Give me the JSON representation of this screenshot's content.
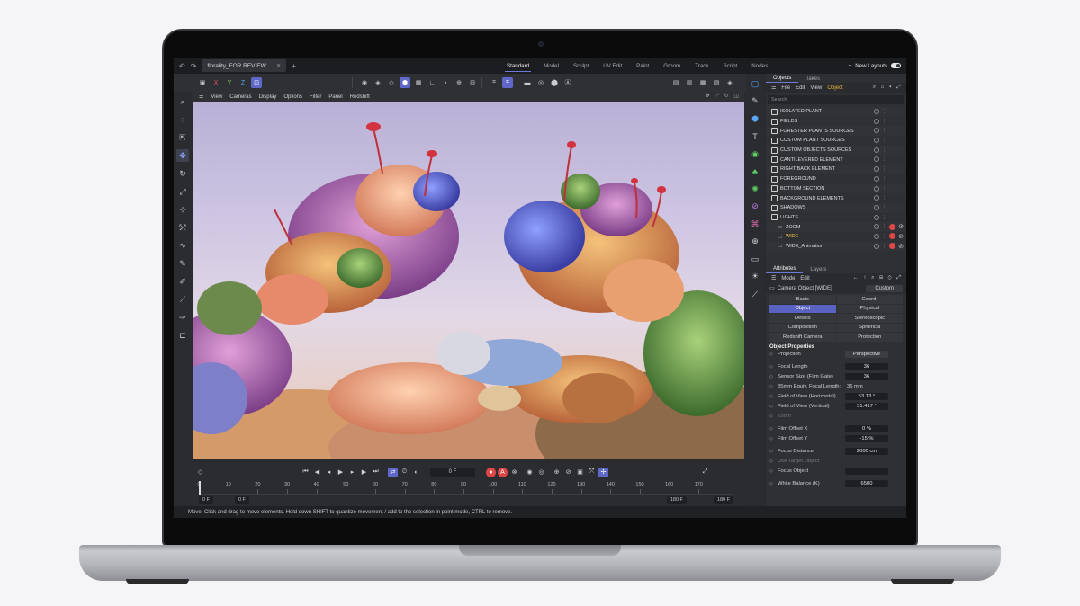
{
  "window": {
    "doc_tab": "florality_FOR REVIEW...",
    "layouts": [
      "Standard",
      "Model",
      "Sculpt",
      "UV Edit",
      "Paint",
      "Groom",
      "Track",
      "Script",
      "Nodes"
    ],
    "active_layout": "Standard",
    "new_layouts_label": "New Layouts"
  },
  "viewport_menu": [
    "View",
    "Cameras",
    "Display",
    "Options",
    "Filter",
    "Panel",
    "Redshift"
  ],
  "axis_labels": [
    "X",
    "Y",
    "Z"
  ],
  "objects_panel": {
    "tabs": [
      "Objects",
      "Takes"
    ],
    "menu": [
      "File",
      "Edit",
      "View",
      "Object"
    ],
    "search_placeholder": "Search",
    "items": [
      {
        "label": "ISOLATED PLANT",
        "kind": "layer"
      },
      {
        "label": "FIELDS",
        "kind": "layer"
      },
      {
        "label": "FORESTER PLANTS SOURCES",
        "kind": "layer"
      },
      {
        "label": "CUSTOM PLANT SOURCES",
        "kind": "layer"
      },
      {
        "label": "CUSTOM OBJECTS SOURCES",
        "kind": "layer"
      },
      {
        "label": "CANTILEVERED ELEMENT",
        "kind": "layer"
      },
      {
        "label": "RIGHT BACK ELEMENT",
        "kind": "layer"
      },
      {
        "label": "FOREGROUND",
        "kind": "layer"
      },
      {
        "label": "BOTTOM SECTION",
        "kind": "layer"
      },
      {
        "label": "BACKGROUND ELEMENTS",
        "kind": "layer"
      },
      {
        "label": "SHADOWS",
        "kind": "layer"
      },
      {
        "label": "LIGHTS",
        "kind": "layer"
      },
      {
        "label": "ZOOM",
        "kind": "camera"
      },
      {
        "label": "WIDE",
        "kind": "camera",
        "highlight": true
      },
      {
        "label": "WIDE_Animation",
        "kind": "camera"
      }
    ]
  },
  "attributes_panel": {
    "tabs": [
      "Attributes",
      "Layers"
    ],
    "menu": [
      "Mode",
      "Edit"
    ],
    "object_name": "Camera Object [WIDE]",
    "preset": "Custom",
    "sub_tabs": [
      "Basic",
      "Coord.",
      "Object",
      "Physical",
      "Details",
      "Stereoscopic",
      "Composition",
      "Spherical",
      "Redshift Camera",
      "Protection"
    ],
    "active_sub_tab": "Object",
    "section_title": "Object Properties",
    "properties": [
      {
        "label": "Projection",
        "value": "Perspective",
        "style": "select"
      },
      {
        "label": "Focal Length",
        "value": "36"
      },
      {
        "label": "Sensor Size (Film Gate)",
        "value": "36"
      },
      {
        "label": "35mm Equiv. Focal Length:",
        "value": "36 mm",
        "style": "plain"
      },
      {
        "label": "Field of View (Horizontal)",
        "value": "53.13 °"
      },
      {
        "label": "Field of View (Vertical)",
        "value": "31.417 °"
      },
      {
        "label": "Zoom",
        "value": "",
        "style": "dim"
      },
      {
        "label": "Film Offset X",
        "value": "0 %"
      },
      {
        "label": "Film Offset Y",
        "value": "-15 %"
      },
      {
        "label": "Focus Distance",
        "value": "2000 cm"
      },
      {
        "label": "Use Target Object",
        "value": "",
        "style": "dim"
      },
      {
        "label": "Focus Object",
        "value": ""
      },
      {
        "label": "White Balance (K)",
        "value": "6500"
      }
    ]
  },
  "timeline": {
    "current_frame": "0 F",
    "ticks": [
      "0",
      "10",
      "20",
      "30",
      "40",
      "50",
      "60",
      "70",
      "80",
      "90",
      "100",
      "110",
      "120",
      "130",
      "140",
      "150",
      "160",
      "170"
    ],
    "start_a": "0 F",
    "start_b": "0 F",
    "end_a": "180 F",
    "end_b": "180 F"
  },
  "status_bar": "Move: Click and drag to move elements. Hold down SHIFT to quantize movement / add to the selection in point mode, CTRL to remove."
}
